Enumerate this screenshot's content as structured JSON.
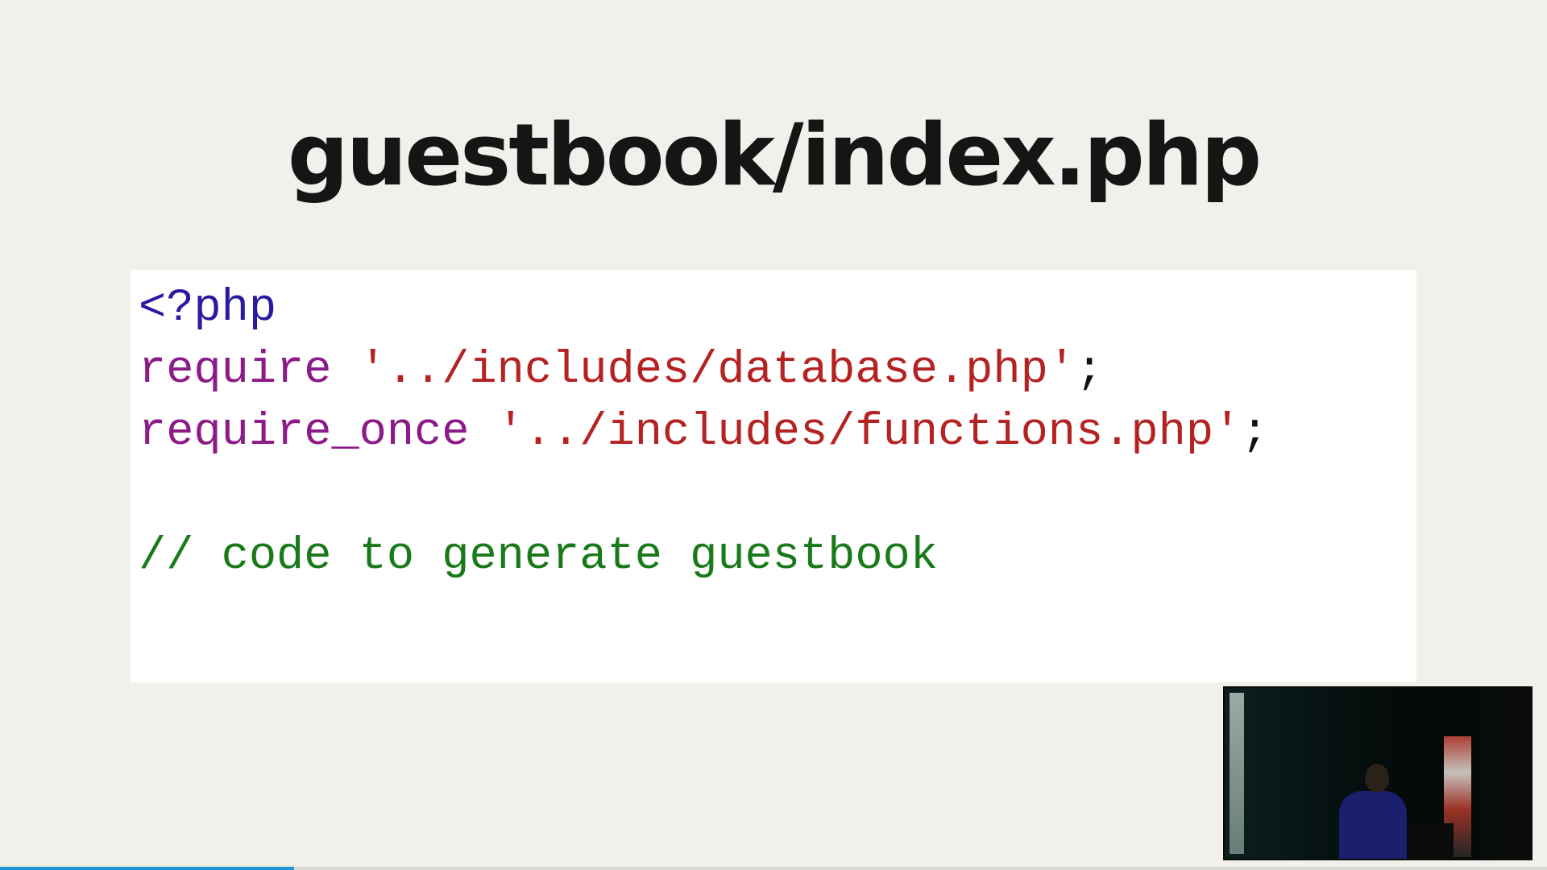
{
  "slide": {
    "title": "guestbook/index.php",
    "code_lines": [
      [
        {
          "text": "<?php",
          "type": "tag"
        }
      ],
      [
        {
          "text": "require ",
          "type": "kw"
        },
        {
          "text": "'../includes/database.php'",
          "type": "str"
        },
        {
          "text": ";",
          "type": "punc"
        }
      ],
      [
        {
          "text": "require_once ",
          "type": "kw"
        },
        {
          "text": "'../includes/functions.php'",
          "type": "str"
        },
        {
          "text": ";",
          "type": "punc"
        }
      ],
      [],
      [
        {
          "text": "// code to generate guestbook",
          "type": "comment"
        }
      ]
    ]
  },
  "webcam": {
    "content": "presenter video feed"
  },
  "progress": {
    "fraction": 0.19,
    "color": "#2196d6"
  },
  "colors": {
    "background": "#f1f0eb",
    "code_background": "#ffffff",
    "tag": "#2a1aa0",
    "keyword": "#8c1a88",
    "string": "#b52222",
    "comment": "#1a7a1a"
  }
}
